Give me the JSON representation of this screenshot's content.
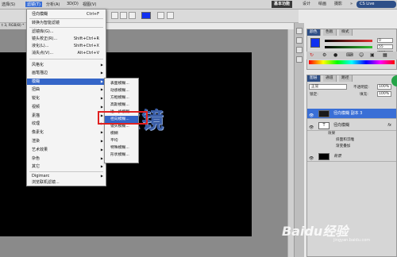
{
  "menubar": {
    "items": [
      "选择(S)",
      "滤镜(T)",
      "分析(A)",
      "3D(D)",
      "视图(V)"
    ],
    "workspaces": [
      "基本功能",
      "设计",
      "绘画",
      "摄影"
    ],
    "more_label": "»",
    "cs_live_label": "CS Live"
  },
  "optbar": {
    "swatch_color": "#1030f0"
  },
  "doc_tab": "t 3, RGB/8) *",
  "canvas_text": "滤镜",
  "filter_menu": {
    "items": [
      {
        "label": "径向模糊",
        "shortcut": "Ctrl+F"
      },
      {
        "label": "转换为智能滤镜",
        "shortcut": ""
      },
      {
        "label": "滤镜库(G)...",
        "shortcut": ""
      },
      {
        "label": "镜头校正(R)...",
        "shortcut": "Shift+Ctrl+R"
      },
      {
        "label": "液化(L)...",
        "shortcut": "Shift+Ctrl+X"
      },
      {
        "label": "消失点(V)...",
        "shortcut": "Alt+Ctrl+V"
      },
      {
        "label": "风格化",
        "shortcut": ""
      },
      {
        "label": "画笔描边",
        "shortcut": ""
      },
      {
        "label": "模糊",
        "shortcut": ""
      },
      {
        "label": "扭曲",
        "shortcut": ""
      },
      {
        "label": "锐化",
        "shortcut": ""
      },
      {
        "label": "视频",
        "shortcut": ""
      },
      {
        "label": "素描",
        "shortcut": ""
      },
      {
        "label": "纹理",
        "shortcut": ""
      },
      {
        "label": "像素化",
        "shortcut": ""
      },
      {
        "label": "渲染",
        "shortcut": ""
      },
      {
        "label": "艺术效果",
        "shortcut": ""
      },
      {
        "label": "杂色",
        "shortcut": ""
      },
      {
        "label": "其它",
        "shortcut": ""
      },
      {
        "label": "Digimarc",
        "shortcut": ""
      },
      {
        "label": "浏览联机滤镜...",
        "shortcut": ""
      }
    ]
  },
  "blur_submenu": {
    "items": [
      "表面模糊...",
      "动感模糊...",
      "方框模糊...",
      "高斯模糊...",
      "进一步模糊",
      "径向模糊...",
      "镜头模糊...",
      "模糊",
      "平均",
      "特殊模糊...",
      "形状模糊..."
    ]
  },
  "color_panel": {
    "tabs": [
      "颜色",
      "色板",
      "样式"
    ],
    "values": [
      "0",
      "55",
      "255"
    ],
    "slider_colors": [
      "#e23030",
      "#30c030",
      "#3050e0"
    ]
  },
  "layers_panel": {
    "tabs": [
      "图层",
      "通道",
      "路径"
    ],
    "blend_mode": "正常",
    "opacity_label": "不透明度:",
    "opacity_value": "100%",
    "lock_label": "锁定:",
    "fill_label": "填充:",
    "fill_value": "100%",
    "layers": [
      {
        "name": "径向模糊 副本 3",
        "selected": true,
        "fx": ""
      },
      {
        "name": "径向模糊",
        "selected": false,
        "fx": "fx"
      },
      {
        "name": "背景",
        "selected": false,
        "fx": ""
      }
    ],
    "effects": [
      "效果",
      "斜面和浮雕",
      "渐变叠加"
    ]
  },
  "watermark": {
    "main": "Baidu经验",
    "sub": "jingyan.baidu.com"
  }
}
